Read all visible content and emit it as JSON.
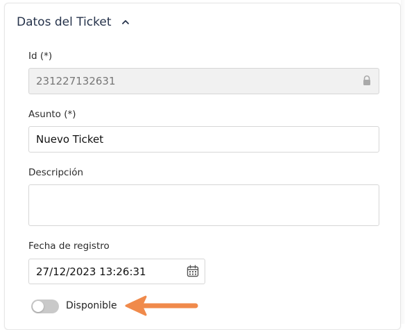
{
  "section": {
    "title": "Datos del Ticket"
  },
  "fields": {
    "id": {
      "label": "Id (*)",
      "value": "231227132631"
    },
    "asunto": {
      "label": "Asunto (*)",
      "value": "Nuevo Ticket"
    },
    "descripcion": {
      "label": "Descripción",
      "value": ""
    },
    "fecha": {
      "label": "Fecha de registro",
      "value": "27/12/2023 13:26:31"
    }
  },
  "toggle": {
    "label": "Disponible",
    "state": "off"
  },
  "colors": {
    "arrow": "#f08a4b",
    "title": "#25324a",
    "toggle_off": "#c9c9c9"
  },
  "icons": [
    "chevron-up-icon",
    "lock-icon",
    "calendar-icon",
    "arrow-left-icon"
  ]
}
